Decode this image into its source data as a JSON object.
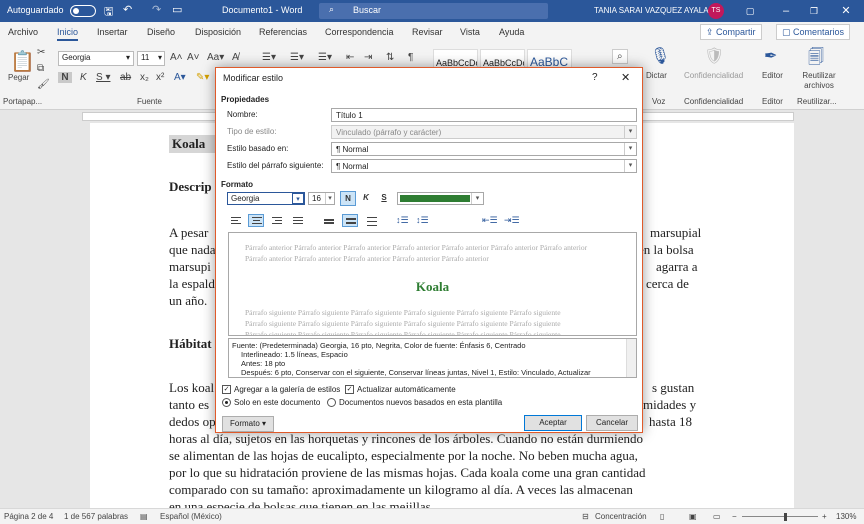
{
  "titlebar": {
    "autosave": "Autoguardado",
    "doc_title": "Documento1 - Word",
    "search": "Buscar",
    "user": "TANIA SARAI VAZQUEZ AYALA",
    "initials": "TS"
  },
  "tabs": [
    "Archivo",
    "Inicio",
    "Insertar",
    "Diseño",
    "Disposición",
    "Referencias",
    "Correspondencia",
    "Revisar",
    "Vista",
    "Ayuda"
  ],
  "share": "Compartir",
  "comments": "Comentarios",
  "ribbon": {
    "paste": "Pegar",
    "clipboard": "Portapap...",
    "font_name": "Georgia",
    "font_size": "11",
    "font_group": "Fuente",
    "style_sample": "AaBbCcDc",
    "style_sample_big": "AaBbC",
    "dictate": "Dictar",
    "voice": "Voz",
    "confidentiality": "Confidencialidad",
    "editor": "Editor",
    "reuse": "Reutilizar archivos",
    "reuse_group": "Reutilizar..."
  },
  "document": {
    "heading": "Koala",
    "subheading": "Descrip",
    "habitat": "Hábitat",
    "para1": [
      "A pesar",
      "que nada",
      "marsupi",
      "la espald",
      "un año."
    ],
    "para1_right": [
      "marsupial",
      "en la bolsa",
      "agarra a",
      "cerca de"
    ],
    "para2": [
      "Los koal",
      "tanto es",
      "dedos op"
    ],
    "para2_right": [
      "s gustan",
      "midades y",
      "hasta 18"
    ],
    "full_lines": [
      "horas al día, sujetos en las horquetas y rincones de los árboles. Cuando no están durmiendo",
      "se alimentan de las hojas de eucalipto, especialmente por la noche. No beben mucha agua,",
      "por lo que su hidratación proviene de las mismas hojas. Cada koala come una gran cantidad",
      "comparado con su tamaño: aproximadamente un kilogramo al día. A veces las almacenan",
      "en una especie de bolsas que tienen en las mejillas."
    ]
  },
  "status": {
    "page": "Página 2 de 4",
    "words": "1 de 567 palabras",
    "lang": "Español (México)",
    "focus": "Concentración",
    "zoom": "130%"
  },
  "dialog": {
    "title": "Modificar estilo",
    "help": "?",
    "close": "✕",
    "section_props": "Propiedades",
    "name_label": "Nombre:",
    "name_value": "Título 1",
    "type_label": "Tipo de estilo:",
    "type_value": "Vinculado (párrafo y carácter)",
    "based_label": "Estilo basado en:",
    "based_value": "¶  Normal",
    "next_label": "Estilo del párrafo siguiente:",
    "next_value": "¶  Normal",
    "section_format": "Formato",
    "font": "Georgia",
    "size": "16",
    "bold": "N",
    "italic": "K",
    "underline": "S",
    "color": "#2e7d32",
    "preview_prev": "Párrafo anterior Párrafo anterior Párrafo anterior Párrafo anterior Párrafo anterior Párrafo anterior Párrafo anterior",
    "preview_prev2": "Párrafo anterior Párrafo anterior Párrafo anterior Párrafo anterior Párrafo anterior",
    "preview_text": "Koala",
    "preview_next": "Párrafo siguiente Párrafo siguiente Párrafo siguiente Párrafo siguiente Párrafo siguiente Párrafo siguiente",
    "desc1": "Fuente: (Predeterminada) Georgia, 16 pto, Negrita, Color de fuente: Énfasis 6, Centrado",
    "desc2": "Interlineado:  1.5 líneas, Espacio",
    "desc3": "Antes:  18 pto",
    "desc4": "Después:  6 pto, Conservar con el siguiente, Conservar líneas juntas, Nivel 1, Estilo: Vinculado, Actualizar",
    "add_gallery": "Agregar a la galería de estilos",
    "auto_update": "Actualizar automáticamente",
    "only_doc": "Solo en este documento",
    "new_docs": "Documentos nuevos basados en esta plantilla",
    "format_btn": "Formato ▾",
    "ok": "Aceptar",
    "cancel": "Cancelar"
  }
}
